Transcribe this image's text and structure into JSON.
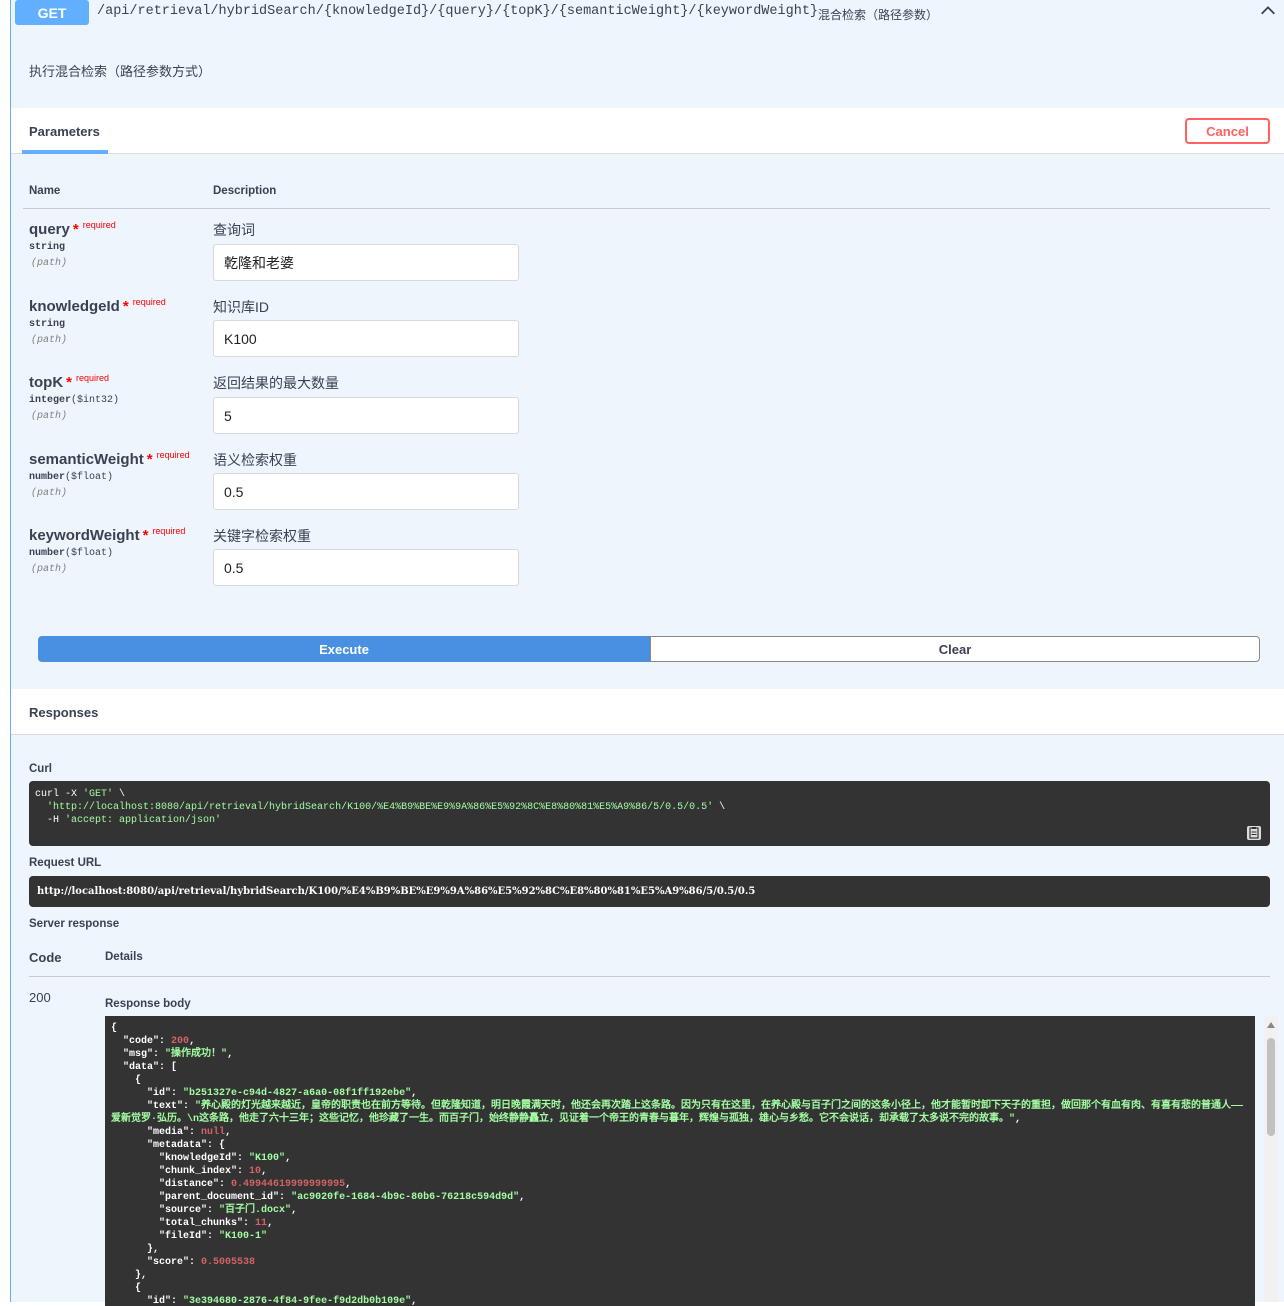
{
  "header": {
    "method": "GET",
    "path": "/api/retrieval/hybridSearch/{knowledgeId}/{query}/{topK}/{semanticWeight}/{keywordWeight}",
    "summary": "混合检索（路径参数）"
  },
  "description": "执行混合检索（路径参数方式）",
  "tabs": {
    "parameters": "Parameters",
    "cancel": "Cancel"
  },
  "columns": {
    "name": "Name",
    "description": "Description"
  },
  "parameters": [
    {
      "name": "query",
      "star": "*",
      "required": "required",
      "type": "string",
      "format": "",
      "in": "(path)",
      "description": "查询词",
      "value": "乾隆和老婆"
    },
    {
      "name": "knowledgeId",
      "star": "*",
      "required": "required",
      "type": "string",
      "format": "",
      "in": "(path)",
      "description": "知识库ID",
      "value": "K100"
    },
    {
      "name": "topK",
      "star": "*",
      "required": "required",
      "type": "integer",
      "format": "($int32)",
      "in": "(path)",
      "description": "返回结果的最大数量",
      "value": "5"
    },
    {
      "name": "semanticWeight",
      "star": "*",
      "required": "required",
      "type": "number",
      "format": "($float)",
      "in": "(path)",
      "description": "语义检索权重",
      "value": "0.5"
    },
    {
      "name": "keywordWeight",
      "star": "*",
      "required": "required",
      "type": "number",
      "format": "($float)",
      "in": "(path)",
      "description": "关键字检索权重",
      "value": "0.5"
    }
  ],
  "buttons": {
    "execute": "Execute",
    "clear": "Clear"
  },
  "responses": {
    "title": "Responses",
    "curl_label": "Curl",
    "curl": {
      "line1_cmd": "curl -X ",
      "line1_method": "'GET'",
      "line1_tail": " \\",
      "line2_url": "'http://localhost:8080/api/retrieval/hybridSearch/K100/%E4%B9%BE%E9%9A%86%E5%92%8C%E8%80%81%E5%A9%86/5/0.5/0.5'",
      "line2_tail": " \\",
      "line3_flag": "-H ",
      "line3_header": "'accept: application/json'"
    },
    "request_url_label": "Request URL",
    "request_url": "http://localhost:8080/api/retrieval/hybridSearch/K100/%E4%B9%BE%E9%9A%86%E5%92%8C%E8%80%81%E5%A9%86/5/0.5/0.5",
    "server_response_label": "Server response",
    "code_header": "Code",
    "details_header": "Details",
    "code": "200",
    "body_label": "Response body",
    "body": {
      "code": "200",
      "msg": "\"操作成功！\"",
      "id": "\"b251327e-c94d-4827-a6a0-08f1ff192ebe\"",
      "text": "\"养心殿的灯光越来越近，皇帝的职责也在前方等待。但乾隆知道，明日晚霞满天时，他还会再次踏上这条路。因为只有在这里，在养心殿与百子门之间的这条小径上，他才能暂时卸下天子的重担，做回那个有血有肉、有喜有悲的普通人——爱新觉罗·弘历。\\n这条路，他走了六十三年；这些记忆，他珍藏了一生。而百子门，始终静静矗立，见证着一个帝王的青春与暮年，辉煌与孤独，雄心与乡愁。它不会说话，却承载了太多说不完的故事。\"",
      "media": "null",
      "knowledgeId": "\"K100\"",
      "chunk_index": "10",
      "distance": "0.49944619999999995",
      "parent_document_id": "\"ac9020fe-1684-4b9c-80b6-76218c594d9d\"",
      "source": "\"百子门.docx\"",
      "total_chunks": "11",
      "fileId": "\"K100-1\"",
      "score": "0.5005538",
      "next_id": "\"3e394680-2876-4f84-9fee-f9d2db0b109e\""
    }
  },
  "colors": {
    "get": "#61affe",
    "cancel": "#ff6060",
    "execute": "#4990e2",
    "code_bg": "#333333",
    "string": "#a2fca2",
    "number": "#d36363"
  }
}
